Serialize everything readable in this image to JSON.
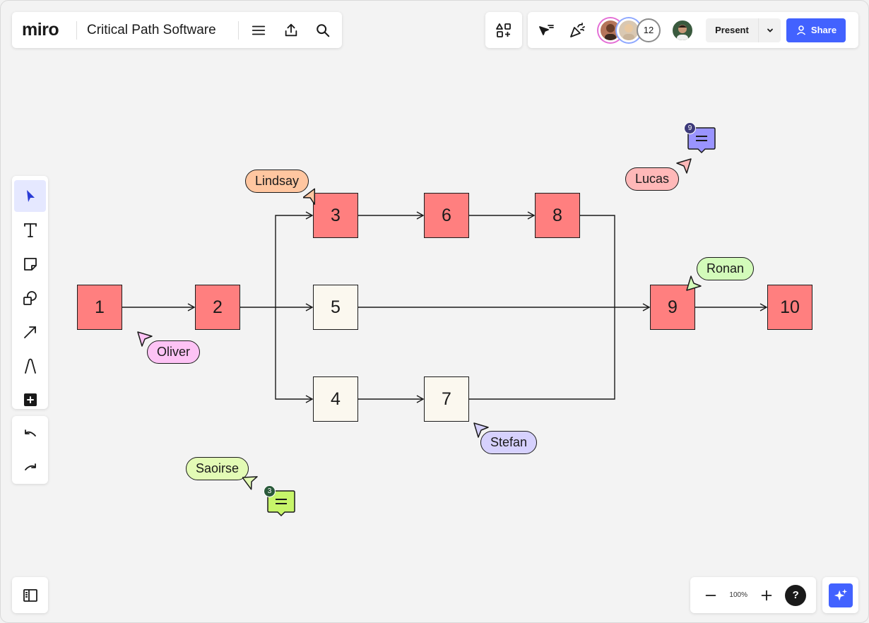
{
  "app": {
    "logo": "miro",
    "board_title": "Critical Path Software"
  },
  "topbar": {
    "collaborator_count": "12",
    "present_label": "Present",
    "share_label": "Share"
  },
  "nodes": [
    {
      "label": "1",
      "critical": true
    },
    {
      "label": "2",
      "critical": true
    },
    {
      "label": "3",
      "critical": true
    },
    {
      "label": "5",
      "critical": false
    },
    {
      "label": "4",
      "critical": false
    },
    {
      "label": "6",
      "critical": true
    },
    {
      "label": "7",
      "critical": false
    },
    {
      "label": "8",
      "critical": true
    },
    {
      "label": "9",
      "critical": true
    },
    {
      "label": "10",
      "critical": true
    }
  ],
  "cursors": {
    "lindsay": "Lindsay",
    "oliver": "Oliver",
    "stefan": "Stefan",
    "ronan": "Ronan",
    "lucas": "Lucas",
    "saoirse": "Saoirse"
  },
  "comments": {
    "top_count": "9",
    "bottom_count": "3"
  },
  "zoom": {
    "level": "100%"
  },
  "colors": {
    "critical_node": "#ff7f7f",
    "normal_node": "#fbf8ef",
    "accent": "#4262ff",
    "lindsay": "#ffc6a0",
    "oliver": "#fdc3f5",
    "stefan": "#d6d1fd",
    "ronan": "#d3fbba",
    "lucas": "#ffb8b8",
    "saoirse": "#e3fbb5"
  }
}
